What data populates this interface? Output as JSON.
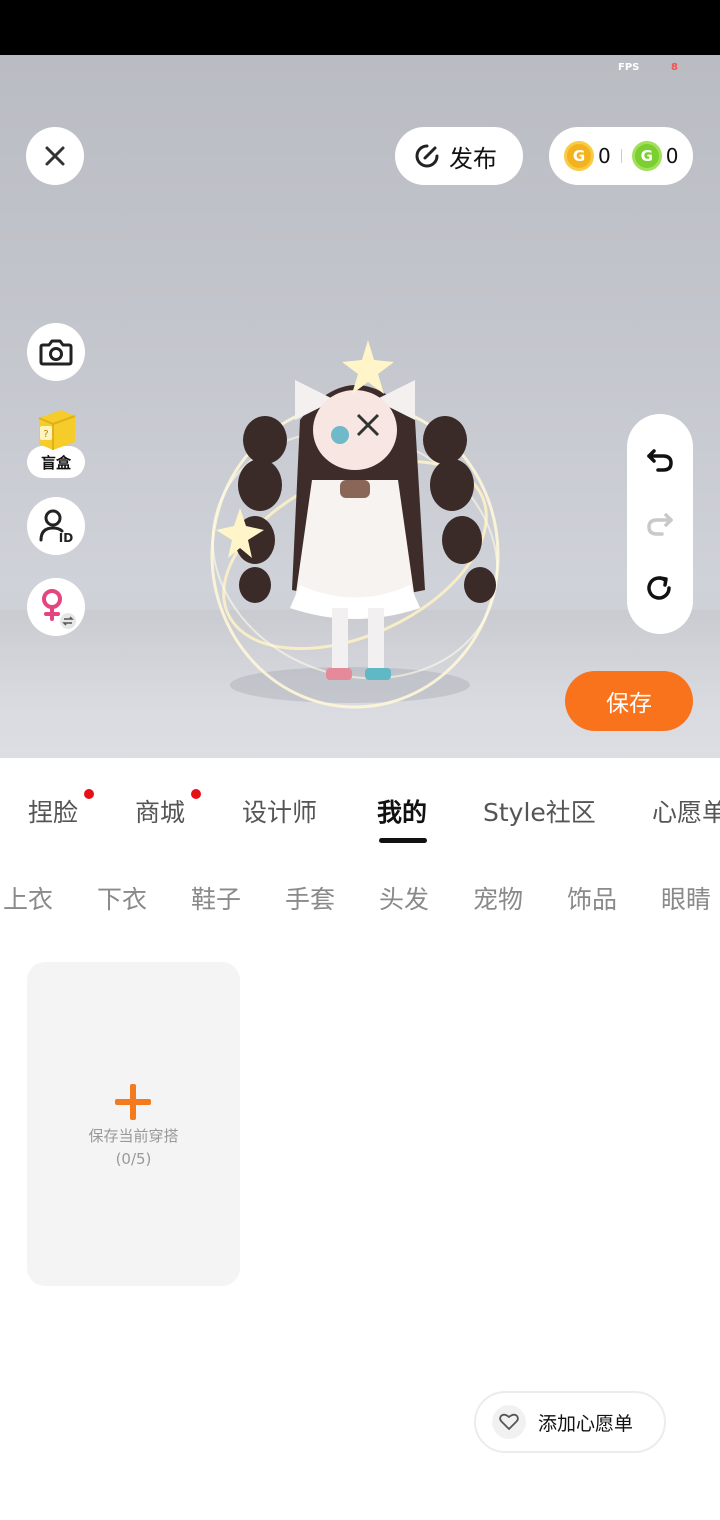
{
  "status_bar": {},
  "hud": {
    "fps_label": "FPS",
    "fps_value": "8"
  },
  "top": {
    "close_icon": "close-icon",
    "publish_label": "发布",
    "currency": [
      {
        "icon": "gold-coin-icon",
        "symbol": "G",
        "value": "0",
        "color": "#f4b31e"
      },
      {
        "icon": "green-coin-icon",
        "symbol": "G",
        "value": "0",
        "color": "#7bcf31"
      }
    ]
  },
  "left_tools": {
    "camera_icon": "camera-icon",
    "blind_box_label": "盲盒",
    "id_icon": "avatar-id-icon",
    "gender_icon": "female-gender-swap-icon"
  },
  "right_tools": {
    "undo_icon": "undo-icon",
    "redo_icon": "redo-icon",
    "reset_icon": "reset-icon"
  },
  "save_label": "保存",
  "tabs": [
    {
      "label": "捏脸",
      "dot": true
    },
    {
      "label": "商城",
      "dot": true
    },
    {
      "label": "设计师",
      "dot": false
    },
    {
      "label": "我的",
      "dot": false,
      "active": true
    },
    {
      "label": "Style社区",
      "dot": false
    },
    {
      "label": "心愿单",
      "dot": false
    }
  ],
  "subtabs": [
    "上衣",
    "下衣",
    "鞋子",
    "手套",
    "头发",
    "宠物",
    "饰品",
    "眼睛"
  ],
  "outfit_card": {
    "label": "保存当前穿搭",
    "count": "(0/5)"
  },
  "wishlist_label": "添加心愿单",
  "colors": {
    "accent": "#f9731d",
    "tab_dot": "#e80f18"
  }
}
